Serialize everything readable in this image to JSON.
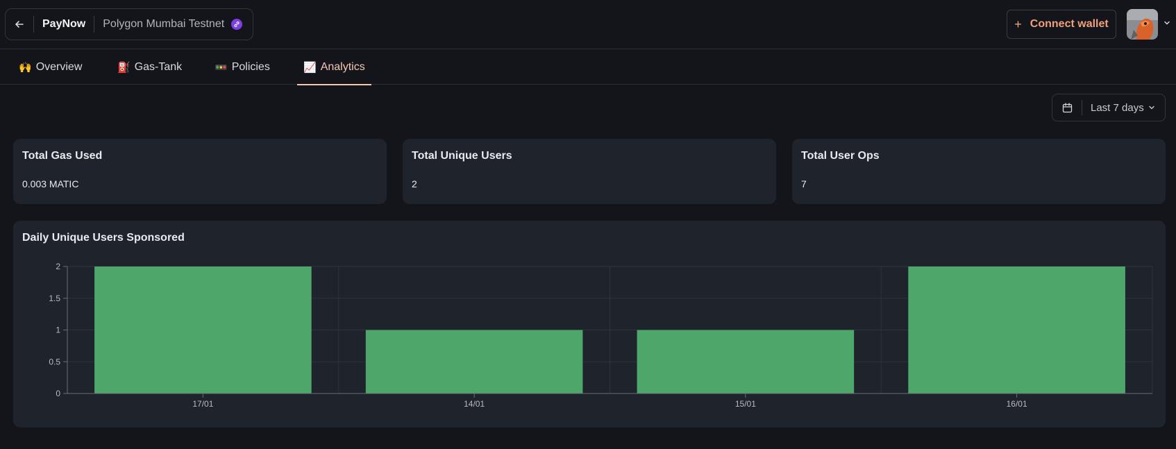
{
  "header": {
    "back_icon": "arrow-left-icon",
    "project_name": "PayNow",
    "network_name": "Polygon Mumbai Testnet",
    "network_icon": "polygon-link-icon",
    "connect_button": {
      "plus": "+",
      "label": "Connect wallet"
    },
    "avatar_icon": "user-avatar",
    "chevron_icon": "chevron-down-icon"
  },
  "tabs": [
    {
      "emoji": "🙌",
      "label": "Overview",
      "active": false
    },
    {
      "emoji": "⛽",
      "label": "Gas-Tank",
      "active": false
    },
    {
      "emoji": "🚥",
      "label": "Policies",
      "active": false
    },
    {
      "emoji": "📈",
      "label": "Analytics",
      "active": true
    }
  ],
  "date_filter": {
    "label": "Last 7 days",
    "icon": "calendar-icon"
  },
  "stats": [
    {
      "title": "Total Gas Used",
      "value": "0.003 MATIC"
    },
    {
      "title": "Total Unique Users",
      "value": "2"
    },
    {
      "title": "Total User Ops",
      "value": "7"
    }
  ],
  "chart_data": {
    "type": "bar",
    "title": "Daily Unique Users Sponsored",
    "categories": [
      "17/01",
      "14/01",
      "15/01",
      "16/01"
    ],
    "values": [
      2,
      1,
      1,
      2
    ],
    "ylim": [
      0,
      2
    ],
    "yticks": [
      "0",
      "0.5",
      "1",
      "1.5",
      "2"
    ],
    "xlabel": "",
    "ylabel": "",
    "grid": true,
    "bar_color": "#4ea66b"
  },
  "colors": {
    "background": "#14151b",
    "card": "#1f232b",
    "accent": "#f0a07a",
    "active_tab": "#f4c8b4"
  }
}
